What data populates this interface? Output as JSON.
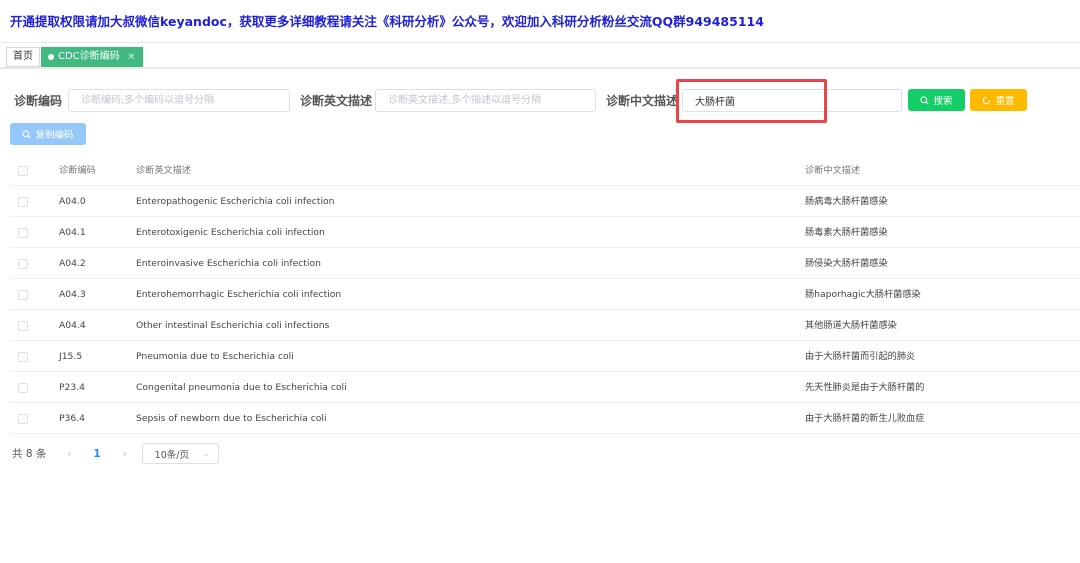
{
  "banner": {
    "text": "开通提取权限请加大叔微信keyandoc，获取更多详细教程请关注《科研分析》公众号，欢迎加入科研分析粉丝交流QQ群949485114"
  },
  "tabs": {
    "home": "首页",
    "active": "CDC诊断编码",
    "close": "×"
  },
  "form": {
    "code_label": "诊断编码",
    "code_placeholder": "诊断编码,多个编码以逗号分隔",
    "en_label": "诊断英文描述",
    "en_placeholder": "诊断英文描述,多个描述以逗号分隔",
    "zh_label": "诊断中文描述",
    "zh_value": "大肠杆菌",
    "search_button": "搜索",
    "reset_button": "重置",
    "copy_button": "复制编码"
  },
  "table": {
    "headers": [
      "诊断编码",
      "诊断英文描述",
      "诊断中文描述"
    ],
    "rows": [
      {
        "code": "A04.0",
        "en": "Enteropathogenic Escherichia coli infection",
        "zh": "肠病毒大肠杆菌感染"
      },
      {
        "code": "A04.1",
        "en": "Enterotoxigenic Escherichia coli infection",
        "zh": "肠毒素大肠杆菌感染"
      },
      {
        "code": "A04.2",
        "en": "Enteroinvasive Escherichia coli infection",
        "zh": "肠侵染大肠杆菌感染"
      },
      {
        "code": "A04.3",
        "en": "Enterohemorrhagic Escherichia coli infection",
        "zh": "肠haporhagic大肠杆菌感染"
      },
      {
        "code": "A04.4",
        "en": "Other intestinal Escherichia coli infections",
        "zh": "其他肠道大肠杆菌感染"
      },
      {
        "code": "J15.5",
        "en": "Pneumonia due to Escherichia coli",
        "zh": "由于大肠杆菌而引起的肺炎"
      },
      {
        "code": "P23.4",
        "en": "Congenital pneumonia due to Escherichia coli",
        "zh": "先天性肺炎是由于大肠杆菌的"
      },
      {
        "code": "P36.4",
        "en": "Sepsis of newborn due to Escherichia coli",
        "zh": "由于大肠杆菌的新生儿败血症"
      }
    ]
  },
  "pagination": {
    "total": "共 8 条",
    "prev": "‹",
    "current": "1",
    "next": "›",
    "page_size": "10条/页",
    "chevron": "⌄"
  },
  "colors": {
    "banner_text": "#1f1fd6",
    "active_tab": "#42b983",
    "search_button": "#13ce66",
    "reset_button": "#ffba00",
    "copy_button": "#94c8fb",
    "highlight": "#e8454b"
  }
}
